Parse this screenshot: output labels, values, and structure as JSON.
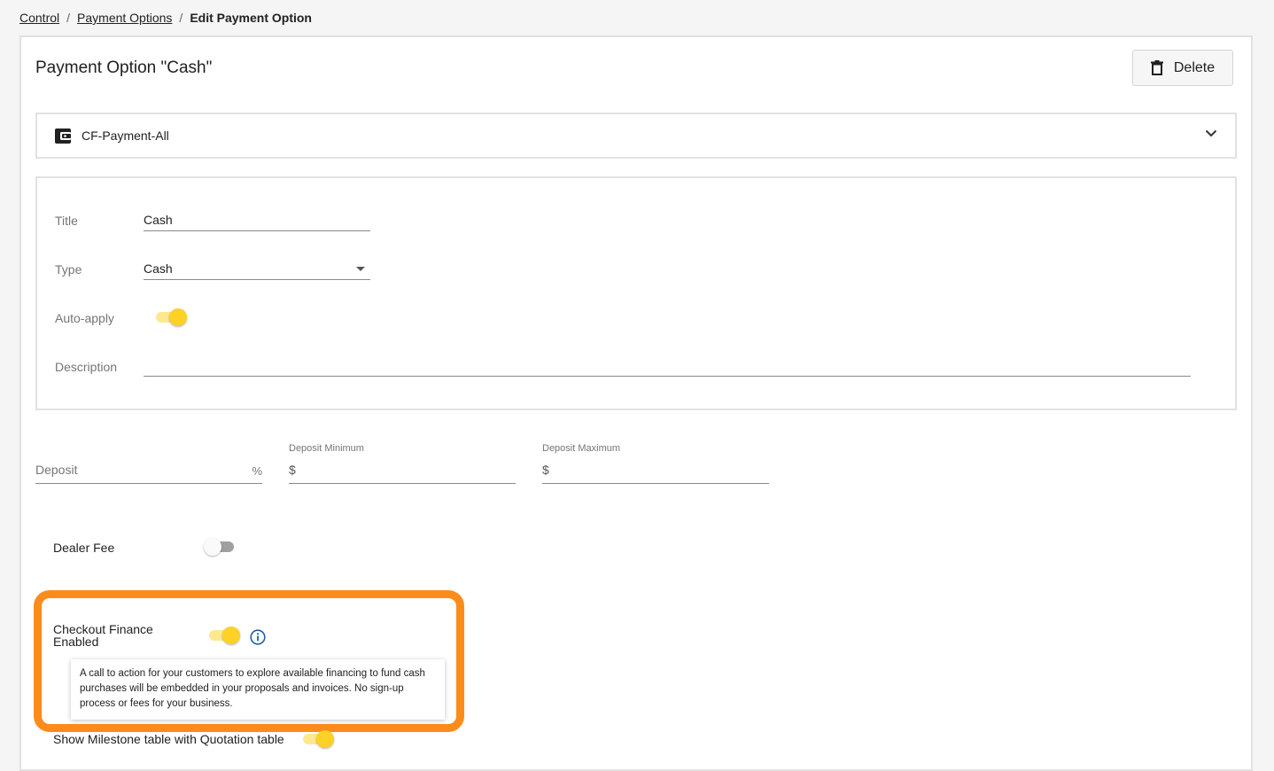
{
  "breadcrumb": {
    "control": "Control",
    "payment_options": "Payment Options",
    "current": "Edit Payment Option",
    "separator": "/"
  },
  "header": {
    "title": "Payment Option \"Cash\"",
    "delete_label": "Delete",
    "delete_icon": "trash-icon"
  },
  "accordion": {
    "icon": "wallet-icon",
    "label": "CF-Payment-All",
    "chevron_icon": "chevron-down-icon"
  },
  "form": {
    "title_label": "Title",
    "title_value": "Cash",
    "type_label": "Type",
    "type_value": "Cash",
    "auto_apply_label": "Auto-apply",
    "auto_apply_on": true,
    "description_label": "Description",
    "description_value": ""
  },
  "deposit": {
    "label": "Deposit",
    "unit": "%",
    "min_label": "Deposit Minimum",
    "min_currency": "$",
    "max_label": "Deposit Maximum",
    "max_currency": "$"
  },
  "dealer_fee": {
    "label": "Dealer Fee",
    "on": false
  },
  "checkout_finance": {
    "label_line1": "Checkout Finance",
    "label_line2": "Enabled",
    "on": true,
    "info_icon": "info-icon",
    "tooltip": "A call to action for your customers to explore available financing to fund cash purchases will be embedded in your proposals and invoices. No sign-up process or fees for your business."
  },
  "milestone": {
    "label": "Show Milestone table with Quotation table",
    "on": true
  },
  "colors": {
    "highlight": "#fb8c1c",
    "toggle_on": "#fdd126",
    "toggle_on_track": "#fce98f",
    "info_blue": "#1f5fa8"
  }
}
